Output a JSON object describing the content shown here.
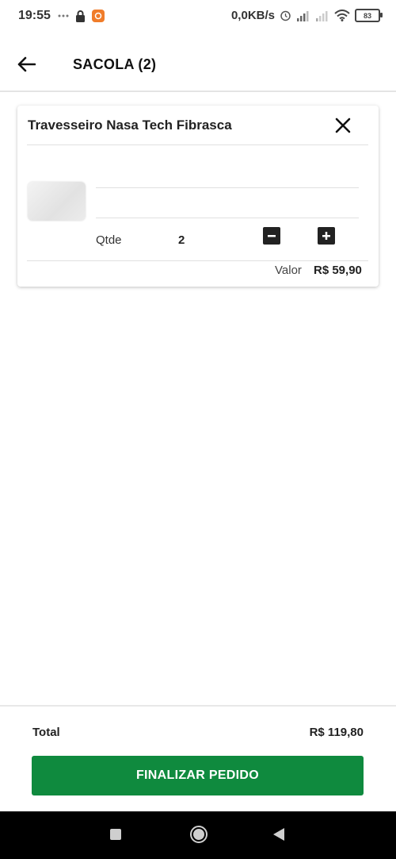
{
  "status_bar": {
    "time": "19:55",
    "speed": "0,0KB/s",
    "battery": "83"
  },
  "header": {
    "title": "SACOLA (2)"
  },
  "cart": {
    "items": [
      {
        "name": "Travesseiro Nasa Tech Fibrasca",
        "qty_label": "Qtde",
        "qty": "2",
        "price_label": "Valor",
        "price": "R$ 59,90"
      }
    ]
  },
  "footer": {
    "total_label": "Total",
    "total_value": "R$ 119,80",
    "checkout_label": "FINALIZAR PEDIDO"
  },
  "colors": {
    "accent": "#0f8a3e"
  },
  "icons": {
    "back": "arrow-left-icon",
    "remove": "close-icon",
    "decrease": "minus-icon",
    "increase": "plus-icon",
    "nav_recent": "square-icon",
    "nav_home": "circle-icon",
    "nav_back": "triangle-icon"
  }
}
